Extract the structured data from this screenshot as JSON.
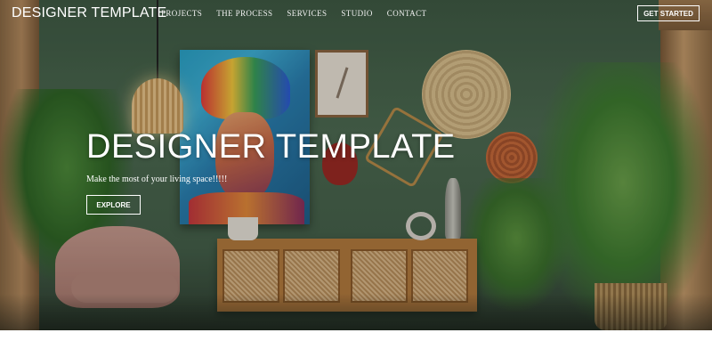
{
  "nav": {
    "brand": "DESIGNER TEMPLATE",
    "links": [
      "PROJECTS",
      "THE PROCESS",
      "SERVICES",
      "STUDIO",
      "CONTACT"
    ],
    "cta_label": "GET STARTED"
  },
  "hero": {
    "title": "DESIGNER TEMPLATE",
    "subtitle": "Make the most of your living space!!!!!",
    "button_label": "EXPLORE"
  },
  "colors": {
    "wall": "#4d6b52",
    "text": "#ffffff",
    "wood": "#b27a3e"
  }
}
